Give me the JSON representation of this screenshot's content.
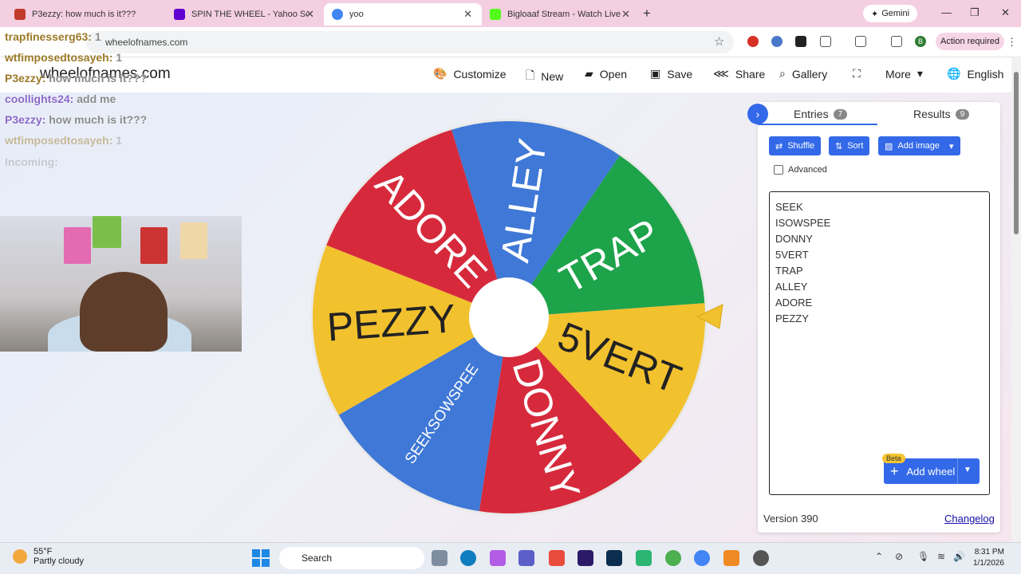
{
  "browser": {
    "tabs": [
      {
        "title": "P3ezzy: how much is it???",
        "icon_color": "#c0392b"
      },
      {
        "title": "SPIN THE WHEEL - Yahoo Search",
        "icon_color": "#6001d2"
      },
      {
        "title": "yoo",
        "icon_color": "#4285f4"
      },
      {
        "title": "Bigloaaf Stream - Watch Live on",
        "icon_color": "#53fc18"
      }
    ],
    "new_tab": "+",
    "gemini_label": "Gemini",
    "url": "wheelofnames.com",
    "action_required": "Action required",
    "profile_initial": "B"
  },
  "site": {
    "title": "wheelofnames.com",
    "nav": [
      {
        "label": "Customize",
        "icon": "palette-icon"
      },
      {
        "label": "New",
        "icon": "file-icon"
      },
      {
        "label": "Open",
        "icon": "folder-icon"
      },
      {
        "label": "Save",
        "icon": "save-icon"
      },
      {
        "label": "Share",
        "icon": "share-icon"
      },
      {
        "label": "Gallery",
        "icon": "search-icon"
      },
      {
        "label": "",
        "icon": "fullscreen-icon"
      },
      {
        "label": "More",
        "icon": "chevron-down-icon"
      },
      {
        "label": "English",
        "icon": "globe-icon"
      }
    ]
  },
  "wheel": {
    "segments": [
      {
        "label": "ALLEY",
        "color": "#3f78d6"
      },
      {
        "label": "TRAP",
        "color": "#1da34a"
      },
      {
        "label": "5VERT",
        "color": "#f2c12e"
      },
      {
        "label": "DONNY",
        "color": "#d62a3c"
      },
      {
        "label": "SEEKSOWSPEE",
        "color": "#3f78d6"
      },
      {
        "label": "PEZZY",
        "color": "#f2c12e"
      },
      {
        "label": "ADORE",
        "color": "#d62a3c"
      }
    ]
  },
  "panel": {
    "tab_entries": "Entries",
    "entries_count": "7",
    "tab_results": "Results",
    "results_count": "9",
    "shuffle": "Shuffle",
    "sort": "Sort",
    "add_image": "Add image",
    "advanced": "Advanced",
    "entries": [
      "SEEK",
      "ISOWSPEE",
      "DONNY",
      "5VERT",
      "TRAP",
      "ALLEY",
      "ADORE",
      "PEZZY"
    ],
    "add_wheel": "Add wheel",
    "beta": "Beta",
    "version": "Version 390",
    "changelog": "Changelog"
  },
  "stream_overlay": {
    "chat": [
      {
        "user": "trapfinesserg63:",
        "msg": "1"
      },
      {
        "user": "wtfimposedtosayeh:",
        "msg": "1"
      },
      {
        "user": "P3ezzy:",
        "msg": "how much is it???"
      },
      {
        "user": "coollights24:",
        "msg": "add me"
      },
      {
        "user": "P3ezzy:",
        "msg": "how much is it???"
      },
      {
        "user": "wtfimposedtosayeh:",
        "msg": "1"
      },
      {
        "user": "Incoming:",
        "msg": ""
      }
    ]
  },
  "taskbar": {
    "weather_temp": "55°F",
    "weather_desc": "Partly cloudy",
    "search_placeholder": "Search",
    "time": "8:31 PM",
    "date": "1/1/2026"
  }
}
